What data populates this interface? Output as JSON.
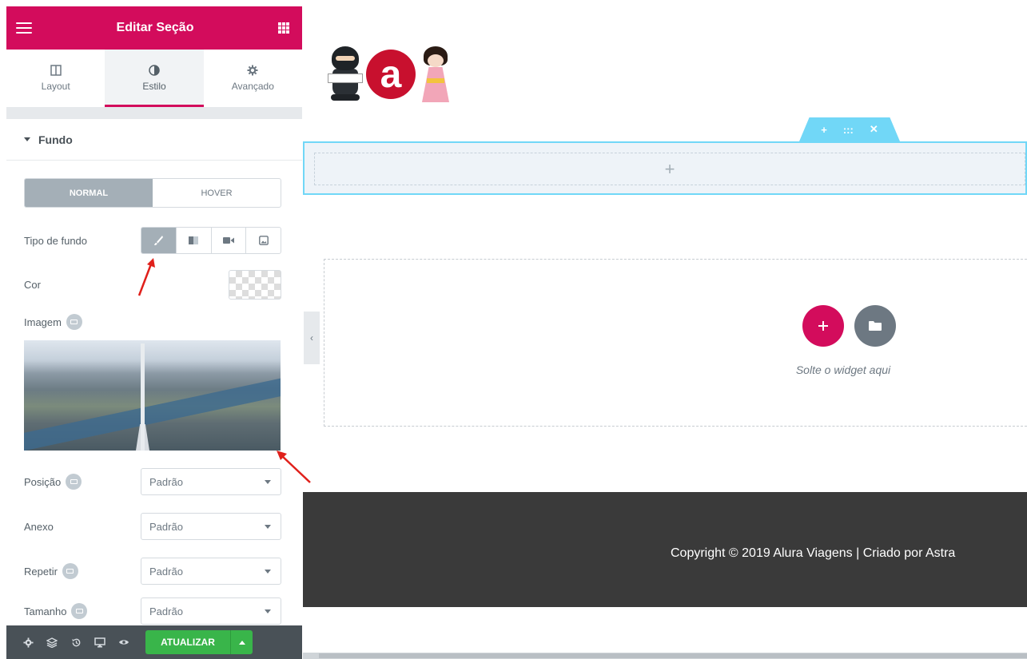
{
  "panel": {
    "title": "Editar Seção",
    "tabs": [
      {
        "label": "Layout",
        "icon": "columns-icon"
      },
      {
        "label": "Estilo",
        "icon": "contrast-icon"
      },
      {
        "label": "Avançado",
        "icon": "gear-icon"
      }
    ],
    "section": {
      "title": "Fundo"
    },
    "state_switch": {
      "normal": "NORMAL",
      "hover": "HOVER",
      "active": "normal"
    },
    "background_type": {
      "label": "Tipo de fundo",
      "options": [
        "classic-brush-icon",
        "gradient-icon",
        "video-icon",
        "slideshow-icon"
      ],
      "selected": 0
    },
    "color": {
      "label": "Cor"
    },
    "image": {
      "label": "Imagem"
    },
    "position": {
      "label": "Posição",
      "value": "Padrão"
    },
    "attachment": {
      "label": "Anexo",
      "value": "Padrão"
    },
    "repeat": {
      "label": "Repetir",
      "value": "Padrão"
    },
    "size": {
      "label": "Tamanho",
      "value": "Padrão"
    }
  },
  "footer_bar": {
    "icons": [
      "gear-icon",
      "layers-icon",
      "history-icon",
      "responsive-icon",
      "eye-icon"
    ],
    "update_label": "ATUALIZAR"
  },
  "preview": {
    "section_controls": {
      "add": "+",
      "move": ":::",
      "close": "✕"
    },
    "empty_section_add": "+",
    "drop_area_text": "Solte o widget aqui",
    "logo_letter": "a",
    "copyright": "Copyright © 2019 Alura Viagens | Criado por Astra"
  },
  "colors": {
    "accent": "#d30c5c",
    "update": "#39b54a",
    "section_outline": "#71d7f7",
    "footer_bg": "#3a3a3a"
  }
}
